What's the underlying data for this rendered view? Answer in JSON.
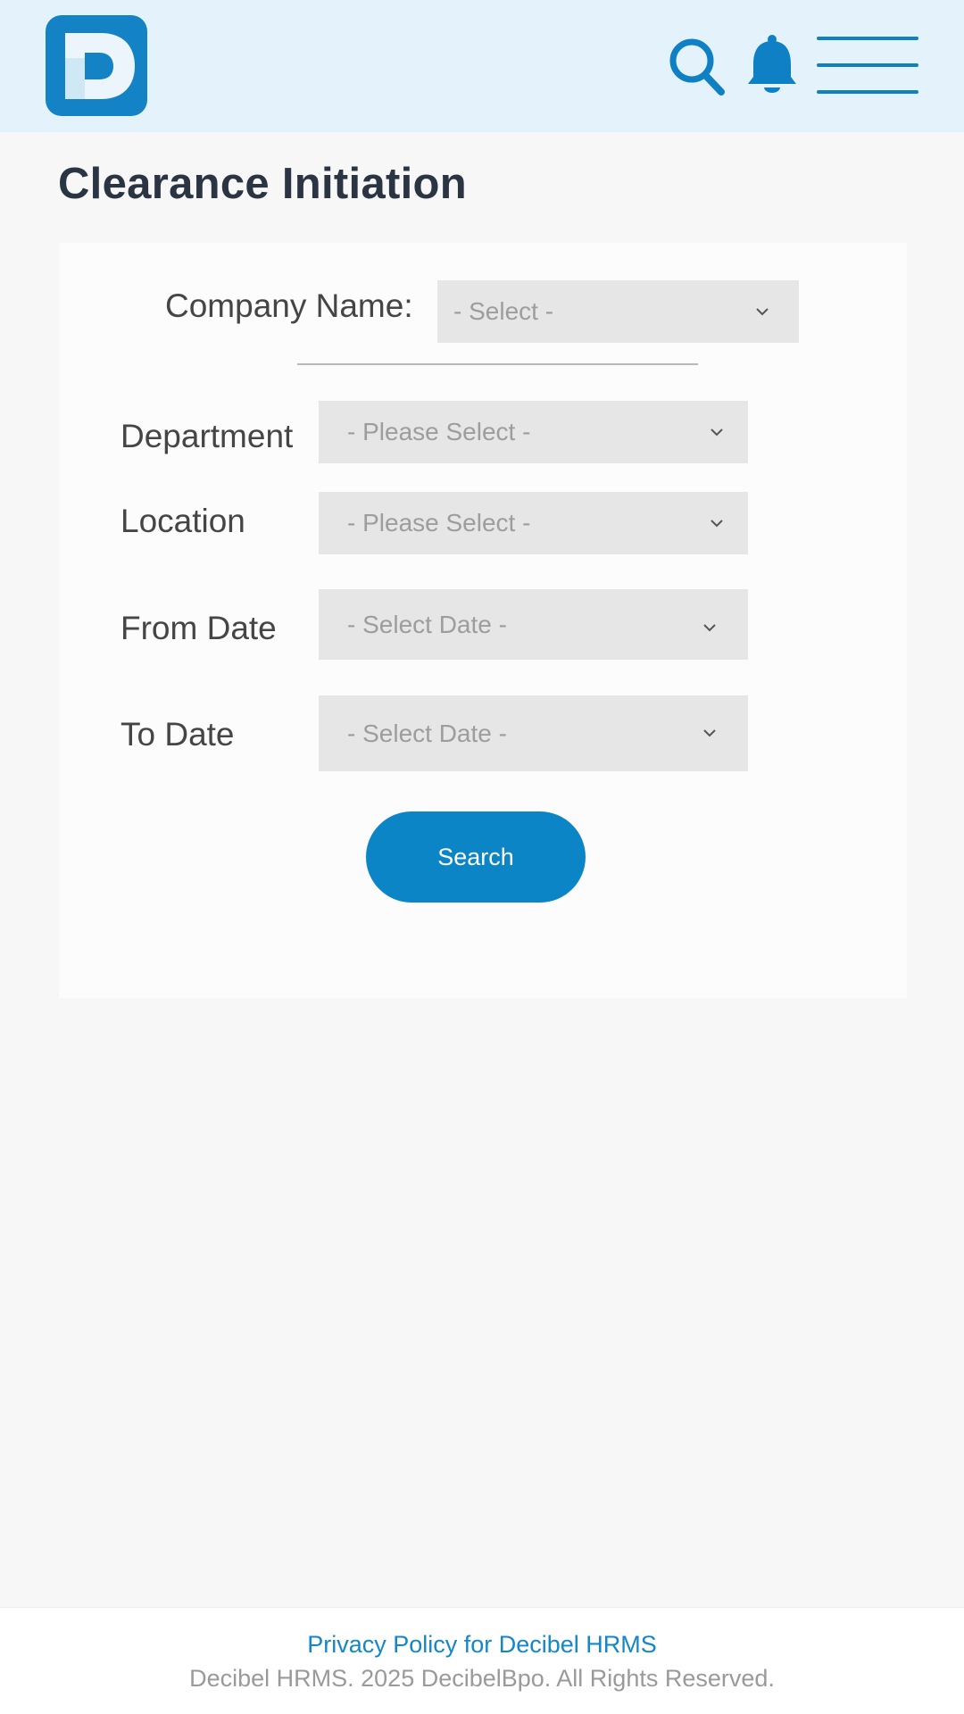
{
  "header": {
    "logo_letter": "D",
    "icons": [
      "search-icon",
      "bell-icon",
      "menu-icon"
    ],
    "accent_color": "#0f80c4"
  },
  "page": {
    "title": "Clearance Initiation"
  },
  "form": {
    "company": {
      "label": "Company Name:",
      "placeholder": "- Select -"
    },
    "department": {
      "label": "Department",
      "placeholder": "- Please Select -"
    },
    "location": {
      "label": "Location",
      "placeholder": "- Please Select -"
    },
    "from_date": {
      "label": "From Date",
      "placeholder": "- Select Date -"
    },
    "to_date": {
      "label": "To Date",
      "placeholder": "- Select Date -"
    },
    "search_label": "Search"
  },
  "footer": {
    "privacy_link": "Privacy Policy for Decibel HRMS",
    "copyright": "Decibel HRMS. 2025 DecibelBpo. All Rights Reserved."
  }
}
